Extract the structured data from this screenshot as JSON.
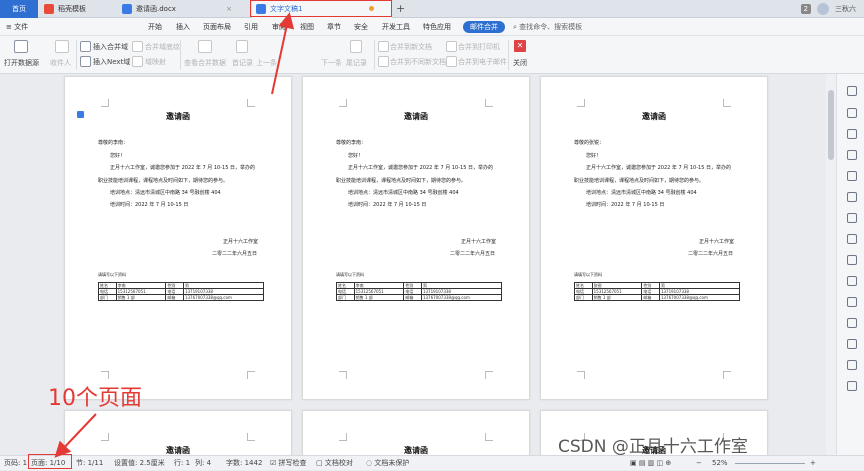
{
  "titlebar": {
    "home": "首页",
    "tabs": [
      {
        "label": "稻壳模板",
        "color": "#e94a3a"
      },
      {
        "label": "邀请函.docx",
        "color": "#3b7be5"
      },
      {
        "label": "文字文稿1",
        "color": "#3b7be5"
      }
    ],
    "close_glyph": "×",
    "plus": "+",
    "count_badge": "2",
    "username": "三秋六"
  },
  "menubar": {
    "file": "文件",
    "items": [
      "开始",
      "插入",
      "页面布局",
      "引用",
      "审阅",
      "视图",
      "章节",
      "安全",
      "开发工具",
      "特色应用"
    ],
    "mail_merge": "邮件合并",
    "search": "查找命令、搜索模板"
  },
  "toolbar": {
    "open_data_source": "打开数据源",
    "recipients": "收件人",
    "insert_merge_field": "插入合并域",
    "insert_next": "插入Next域",
    "merge_field_shading": "合并域底纹",
    "field_map": "域映射",
    "view_merged_data": "查看合并数据",
    "first_record": "首记录",
    "prev_record": "上一条",
    "next_record": "下一条",
    "last_record": "尾记录",
    "merge_to_new_doc": "合并到新文档",
    "merge_to_diff_new_doc": "合并到不同新文档",
    "merge_to_printer": "合并到打印机",
    "merge_to_email": "合并到电子邮件",
    "close": "关闭"
  },
  "page": {
    "title": "邀请函",
    "greeting": "尊敬的李南：",
    "greeting_alt": "尊敬的张锐：",
    "hello": "您好！",
    "body1": "正月十六工作室，诚邀您参加于 2022 年 7 月 10-15 日，举办的",
    "body2": "职业技能培训课程，课程地点及时间如下，期待您的参与。",
    "location": "培训地点：清远市清城区中南路 34 号融创楼 404",
    "time": "培训时间：2022 年 7 月 10-15 日",
    "sign_org": "正月十六工作室",
    "sign_date": "二零二二年六月五日",
    "table_title": "请填写以下资料",
    "row1": [
      "姓名",
      "李南",
      "性别",
      "男"
    ],
    "row1b": [
      "姓名",
      "张锐",
      "性别",
      "男"
    ],
    "row2": [
      "电话",
      "15312567051",
      "电话",
      "13719107338"
    ],
    "row3": [
      "部门",
      "销售 1 部",
      "邮箱",
      "13767007338@qq.com"
    ]
  },
  "statusbar": {
    "page_num": "页码: 1",
    "pages": "页面: 1/10",
    "section": "节: 1/11",
    "margin": "设置值: 2.5厘米",
    "row": "行: 1",
    "col": "列: 4",
    "words": "字数: 1442",
    "spell": "拼写检查",
    "proof": "文档校对",
    "protect": "文档未保护",
    "zoom": "52%",
    "minus": "−",
    "plus": "+"
  },
  "annotation": {
    "label": "10个页面",
    "color": "#e53935"
  },
  "watermark": "CSDN @正月十六工作室"
}
